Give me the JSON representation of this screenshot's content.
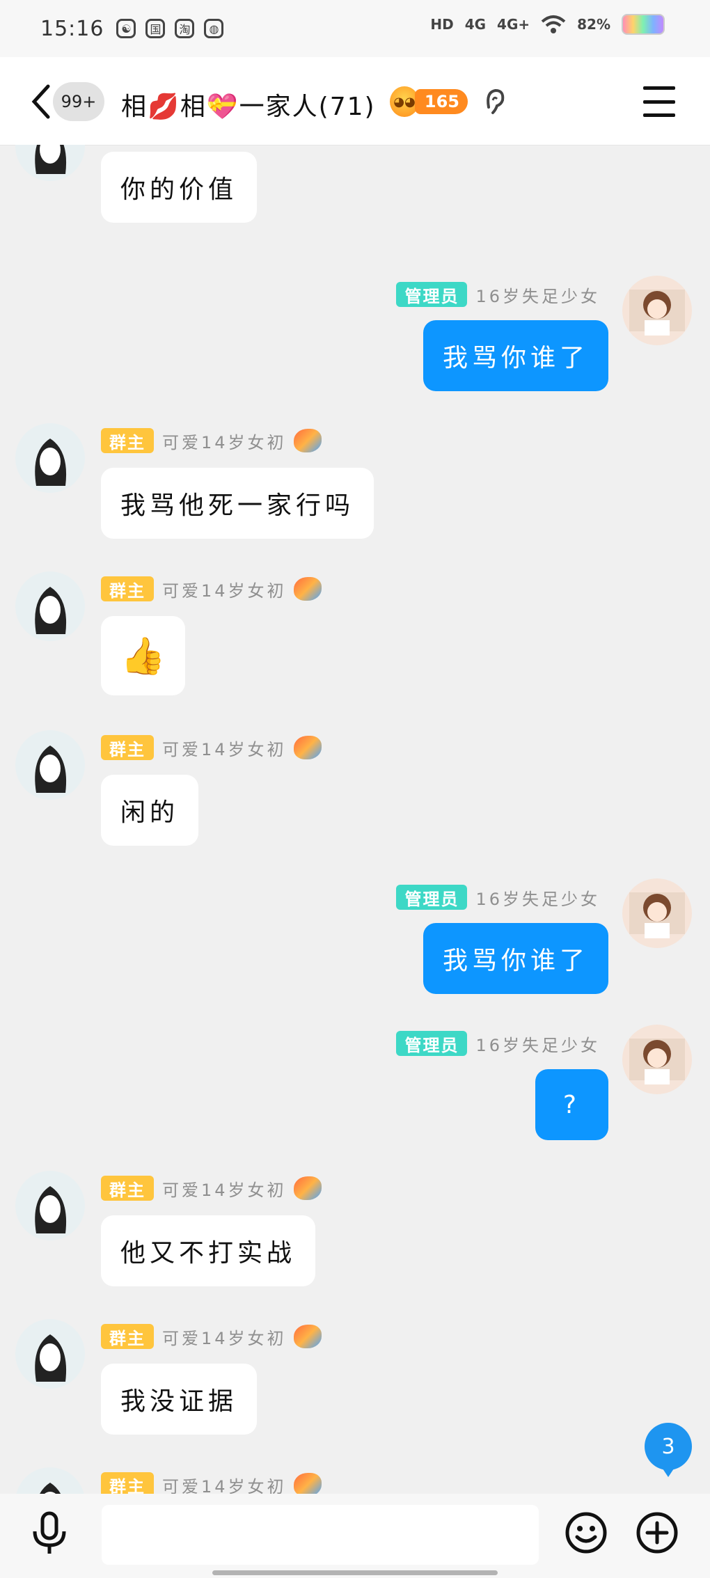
{
  "status_bar": {
    "time": "15:16",
    "app_icons": [
      "☯",
      "国",
      "淘",
      "◍"
    ],
    "hd_label": "HD",
    "network_1": "4G",
    "network_2": "4G+",
    "battery": "82%"
  },
  "header": {
    "unread_count": "99+",
    "group_name": "相💋相💝一家人(71)",
    "fire_value": "165"
  },
  "labels": {
    "owner_badge": "群主",
    "admin_badge": "管理员",
    "owner_nick": "可爱14岁女初",
    "admin_nick": "16岁失足少女"
  },
  "messages": [
    {
      "side": "left",
      "role": "owner",
      "text": "你的价值"
    },
    {
      "side": "right",
      "role": "admin",
      "text": "我骂你谁了"
    },
    {
      "side": "left",
      "role": "owner",
      "text": "我骂他死一家行吗"
    },
    {
      "side": "left",
      "role": "owner",
      "text": "👍"
    },
    {
      "side": "left",
      "role": "owner",
      "text": "闲的"
    },
    {
      "side": "right",
      "role": "admin",
      "text": "我骂你谁了"
    },
    {
      "side": "right",
      "role": "admin",
      "text": "?"
    },
    {
      "side": "left",
      "role": "owner",
      "text": "他又不打实战"
    },
    {
      "side": "left",
      "role": "owner",
      "text": "我没证据"
    },
    {
      "side": "left",
      "role": "owner",
      "text": ""
    }
  ],
  "new_message_count": "3",
  "input": {
    "value": "",
    "placeholder": ""
  }
}
